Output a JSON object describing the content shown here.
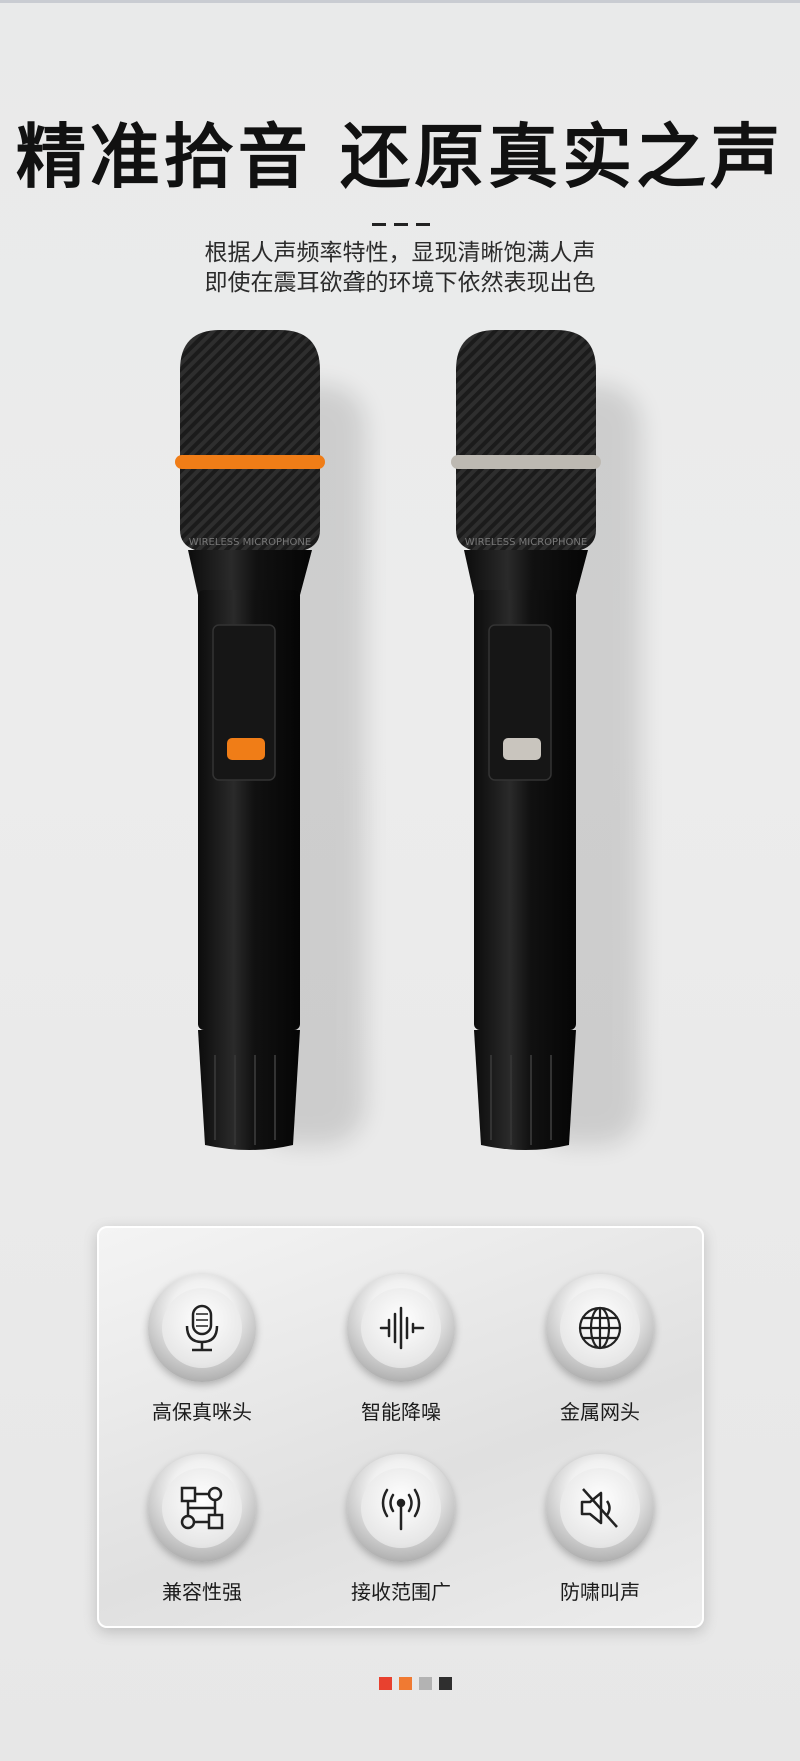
{
  "headline": "精准拾音  还原真实之声",
  "subtitle": {
    "line1": "根据人声频率特性，显现清晰饱满人声",
    "line2": "即使在震耳欲聋的环境下依然表现出色"
  },
  "microphones": [
    {
      "ring_color": "#f07d17",
      "button_color": "#f07d17",
      "label": "WIRELESS MICROPHONE"
    },
    {
      "ring_color": "#bdb9b2",
      "button_color": "#c9c5be",
      "label": "WIRELESS MICROPHONE"
    }
  ],
  "features": [
    {
      "label": "高保真咪头",
      "icon": "microphone-icon"
    },
    {
      "label": "智能降噪",
      "icon": "sound-wave-icon"
    },
    {
      "label": "金属网头",
      "icon": "globe-mesh-icon"
    },
    {
      "label": "兼容性强",
      "icon": "network-nodes-icon"
    },
    {
      "label": "接收范围广",
      "icon": "antenna-signal-icon"
    },
    {
      "label": "防啸叫声",
      "icon": "speaker-mute-icon"
    }
  ],
  "color_swatches": [
    "#e8412f",
    "#f07a32",
    "#b3b3b3",
    "#2f2f2f"
  ]
}
